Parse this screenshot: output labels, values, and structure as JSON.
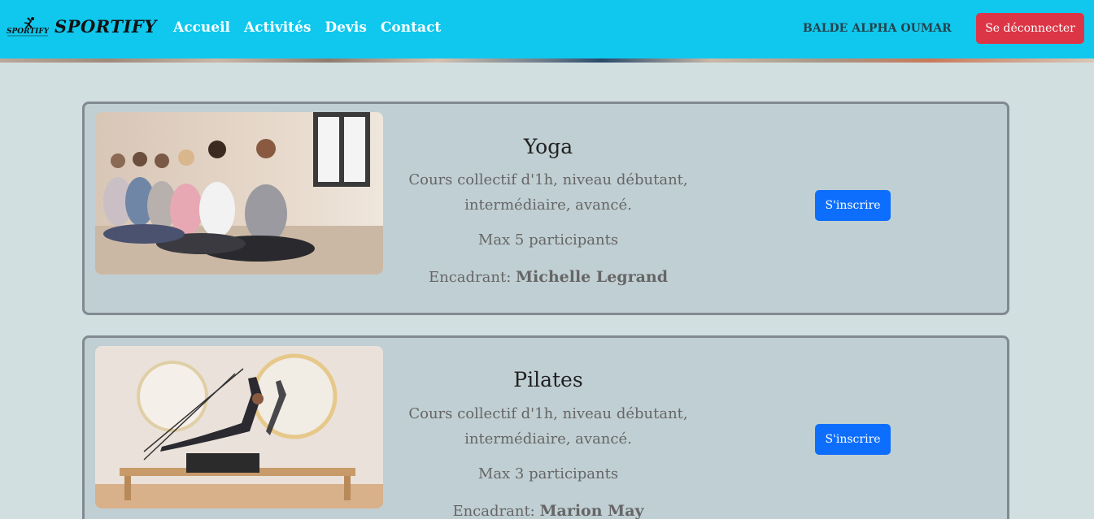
{
  "nav": {
    "brand": "SPORTIFY",
    "logo_text": "SPORTIFY",
    "links": [
      "Accueil",
      "Activités",
      "Devis",
      "Contact"
    ],
    "user_name": "BALDE ALPHA OUMAR",
    "logout_label": "Se déconnecter"
  },
  "activities": [
    {
      "title": "Yoga",
      "description": "Cours collectif d'1h, niveau débutant, intermédiaire, avancé.",
      "max": "Max 5 participants",
      "coach_label": "Encadrant:",
      "coach_name": "Michelle Legrand",
      "button": "S'inscrire"
    },
    {
      "title": "Pilates",
      "description": "Cours collectif d'1h, niveau débutant, intermédiaire, avancé.",
      "max": "Max 3 participants",
      "coach_label": "Encadrant:",
      "coach_name": "Marion May",
      "button": "S'inscrire"
    }
  ],
  "colors": {
    "navbar": "#10c8ee",
    "logout": "#dc3545",
    "enroll": "#0d6efd",
    "background": "#d1dfe1",
    "card": "#c0cfd3"
  }
}
